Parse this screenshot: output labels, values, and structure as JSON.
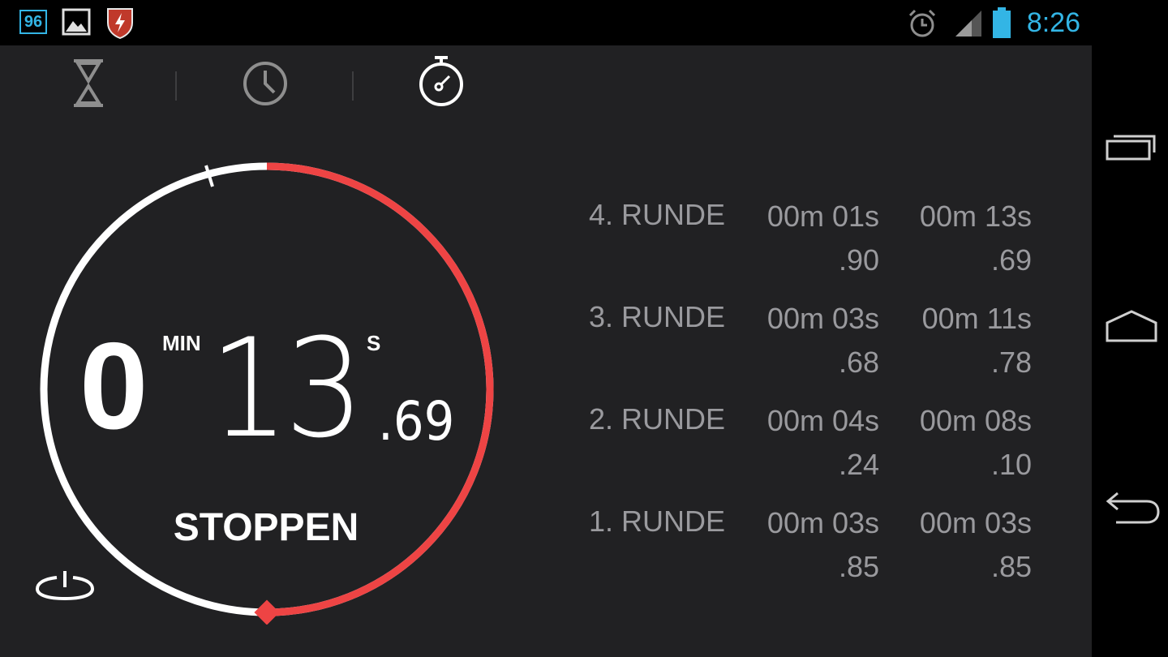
{
  "status_bar": {
    "notification_count": "96",
    "time": "8:26",
    "icons": [
      "notification-badge-icon",
      "image-icon",
      "shield-app-icon",
      "alarm-icon",
      "signal-icon",
      "battery-icon"
    ]
  },
  "tabs": [
    {
      "name": "timer",
      "icon": "hourglass-icon",
      "active": false
    },
    {
      "name": "clock",
      "icon": "clock-icon",
      "active": false
    },
    {
      "name": "stopwatch",
      "icon": "stopwatch-icon",
      "active": true
    }
  ],
  "stopwatch": {
    "minutes": "0",
    "minutes_unit": "MIN",
    "seconds": "13",
    "seconds_unit": "S",
    "hundredths": ".69",
    "stop_label": "STOPPEN",
    "lap_progress_fraction": 0.5
  },
  "laps": [
    {
      "label": "4. RUNDE",
      "lap_time": "00m 01s",
      "lap_hund": ".90",
      "total_time": "00m 13s",
      "total_hund": ".69"
    },
    {
      "label": "3. RUNDE",
      "lap_time": "00m 03s",
      "lap_hund": ".68",
      "total_time": "00m 11s",
      "total_hund": ".78"
    },
    {
      "label": "2. RUNDE",
      "lap_time": "00m 04s",
      "lap_hund": ".24",
      "total_time": "00m 08s",
      "total_hund": ".10"
    },
    {
      "label": "1. RUNDE",
      "lap_time": "00m 03s",
      "lap_hund": ".85",
      "total_time": "00m 03s",
      "total_hund": ".85"
    }
  ],
  "colors": {
    "accent_blue": "#33b5e5",
    "progress_red": "#ee4444",
    "background": "#212123",
    "lap_text": "#9a9a9e"
  },
  "nav_bar": [
    "recent-apps-icon",
    "home-icon",
    "back-icon"
  ]
}
